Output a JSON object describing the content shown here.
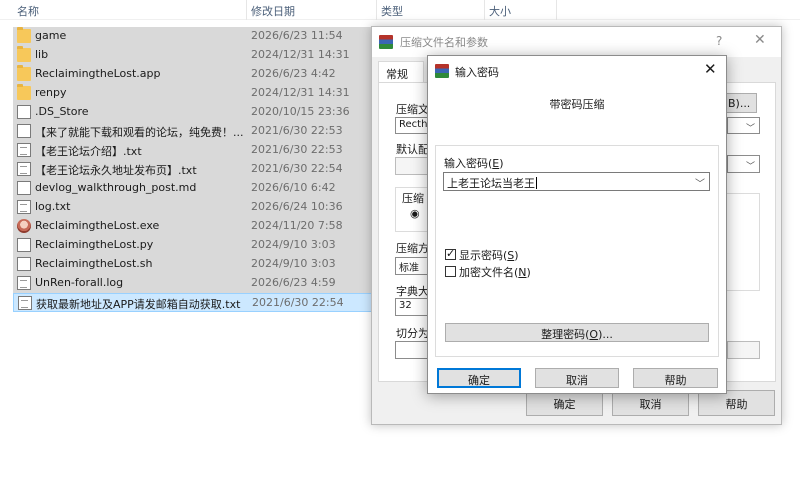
{
  "explorer": {
    "columns": {
      "name": "名称",
      "modified": "修改日期",
      "type": "类型",
      "size": "大小"
    },
    "files": [
      {
        "name": "game",
        "date": "2026/6/23 11:54",
        "icon": "folder-icon"
      },
      {
        "name": "lib",
        "date": "2024/12/31 14:31",
        "icon": "folder-icon"
      },
      {
        "name": "ReclaimingtheLost.app",
        "date": "2026/6/23 4:42",
        "icon": "folder-icon"
      },
      {
        "name": "renpy",
        "date": "2024/12/31 14:31",
        "icon": "folder-icon"
      },
      {
        "name": ".DS_Store",
        "date": "2020/10/15 23:36",
        "icon": "file-icon"
      },
      {
        "name": "【来了就能下载和观看的论坛，纯免费！...",
        "date": "2021/6/30 22:53",
        "icon": "file-icon"
      },
      {
        "name": "【老王论坛介绍】.txt",
        "date": "2021/6/30 22:53",
        "icon": "text-file-icon"
      },
      {
        "name": "【老王论坛永久地址发布页】.txt",
        "date": "2021/6/30 22:54",
        "icon": "text-file-icon"
      },
      {
        "name": "devlog_walkthrough_post.md",
        "date": "2026/6/10 6:42",
        "icon": "file-icon"
      },
      {
        "name": "log.txt",
        "date": "2026/6/24 10:36",
        "icon": "text-file-icon"
      },
      {
        "name": "ReclaimingtheLost.exe",
        "date": "2024/11/20 7:58",
        "icon": "app-icon"
      },
      {
        "name": "ReclaimingtheLost.py",
        "date": "2024/9/10 3:03",
        "icon": "file-icon"
      },
      {
        "name": "ReclaimingtheLost.sh",
        "date": "2024/9/10 3:03",
        "icon": "file-icon"
      },
      {
        "name": "UnRen-forall.log",
        "date": "2026/6/23 4:59",
        "icon": "text-file-icon"
      },
      {
        "name": "获取最新地址及APP请发邮箱自动获取.txt",
        "date": "2021/6/30 22:54",
        "icon": "text-file-icon",
        "selected": true
      }
    ]
  },
  "archive_dialog": {
    "title": "压缩文件名和参数",
    "help": "?",
    "close": "✕",
    "tab_general": "常规",
    "archive_name_label": "压缩文",
    "archive_name_value": "Recthe",
    "browse_btn": "(B)...",
    "default_profile_label": "默认配",
    "compress_group_label": "压缩",
    "radio_label": "◉",
    "method_label": "压缩方",
    "method_value": "标准",
    "dict_label": "字典大",
    "dict_value": "32",
    "split_label": "切分为",
    "ok_label": "确定",
    "cancel_label": "取消",
    "help_label": "帮助"
  },
  "password_dialog": {
    "title": "输入密码",
    "close": "✕",
    "heading": "带密码压缩",
    "password_label": "输入密码(",
    "password_label_key": "E",
    "password_label_end": ")",
    "password_value": "上老王论坛当老王",
    "show_password_label": "显示密码(",
    "show_password_key": "S",
    "show_password_end": ")",
    "show_password_checked": true,
    "encrypt_names_label": "加密文件名(",
    "encrypt_names_key": "N",
    "encrypt_names_end": ")",
    "encrypt_names_checked": false,
    "organize_label": "整理密码(",
    "organize_key": "O",
    "organize_end": ")...",
    "ok_label": "确定",
    "cancel_label": "取消",
    "help_label": "帮助"
  }
}
